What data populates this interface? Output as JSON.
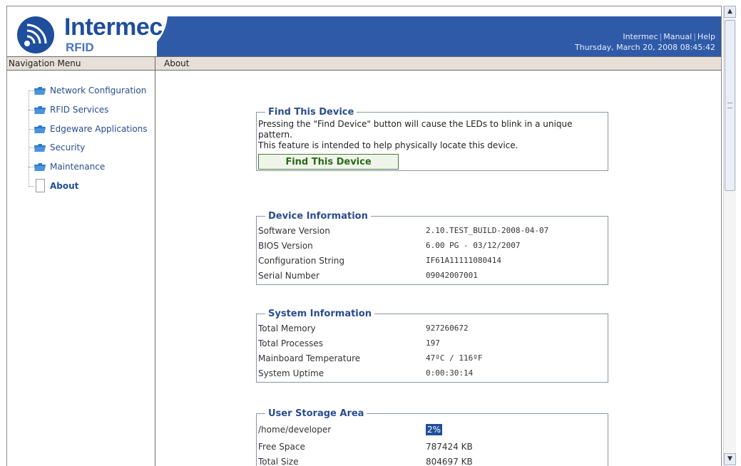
{
  "header": {
    "brand": "Intermec",
    "brand_sub": "RFID",
    "links": [
      "Intermec",
      "Manual",
      "Help"
    ],
    "datetime": "Thursday, March 20, 2008 08:45:42"
  },
  "menu_row": {
    "nav_title": "Navigation Menu",
    "page_title": "About"
  },
  "sidebar": {
    "items": [
      {
        "label": "Network Configuration",
        "icon": "folder-icon"
      },
      {
        "label": "RFID Services",
        "icon": "folder-icon"
      },
      {
        "label": "Edgeware Applications",
        "icon": "folder-icon"
      },
      {
        "label": "Security",
        "icon": "folder-icon"
      },
      {
        "label": "Maintenance",
        "icon": "folder-icon"
      },
      {
        "label": "About",
        "icon": "page-icon",
        "active": true
      }
    ]
  },
  "find_device": {
    "legend": "Find This Device",
    "description_1": "Pressing the \"Find Device\" button will cause the LEDs to blink in a unique pattern.",
    "description_2": "This feature is intended to help physically locate this device.",
    "button_label": "Find This Device"
  },
  "device_info": {
    "legend": "Device Information",
    "rows": [
      {
        "key": "Software Version",
        "value": "2.10.TEST_BUILD-2008-04-07"
      },
      {
        "key": "BIOS Version",
        "value": "6.00 PG - 03/12/2007"
      },
      {
        "key": "Configuration String",
        "value": "IF61A11111080414"
      },
      {
        "key": "Serial Number",
        "value": "09042007001"
      }
    ]
  },
  "system_info": {
    "legend": "System Information",
    "rows": [
      {
        "key": "Total Memory",
        "value": "927260672"
      },
      {
        "key": "Total Processes",
        "value": "197"
      },
      {
        "key": "Mainboard Temperature",
        "value": "47ºC / 116ºF"
      },
      {
        "key": "System Uptime",
        "value": "0:00:30:14"
      }
    ]
  },
  "storage": {
    "legend": "User Storage Area",
    "path": "/home/developer",
    "used_percent": "2%",
    "rows": [
      {
        "key": "Free Space",
        "value": "787424 KB"
      },
      {
        "key": "Total Size",
        "value": "804697 KB"
      }
    ]
  },
  "colors": {
    "header_blue": "#2f5aa8",
    "brand_blue": "#1f4e9c",
    "menu_bg": "#e6e0d8",
    "button_green": "#2a6a1a"
  }
}
